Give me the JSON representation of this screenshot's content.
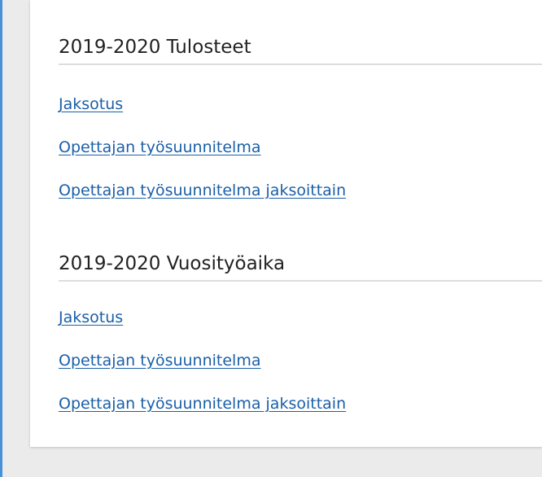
{
  "colors": {
    "accent": "#4a90d9",
    "link": "#1a5fa8",
    "page_background": "#ebebeb",
    "card_background": "#ffffff"
  },
  "sections": [
    {
      "title": "2019-2020 Tulosteet",
      "links": [
        {
          "label": "Jaksotus"
        },
        {
          "label": "Opettajan työsuunnitelma"
        },
        {
          "label": "Opettajan työsuunnitelma jaksoittain"
        }
      ]
    },
    {
      "title": "2019-2020 Vuosityöaika",
      "links": [
        {
          "label": "Jaksotus"
        },
        {
          "label": "Opettajan työsuunnitelma"
        },
        {
          "label": "Opettajan työsuunnitelma jaksoittain"
        }
      ]
    }
  ]
}
